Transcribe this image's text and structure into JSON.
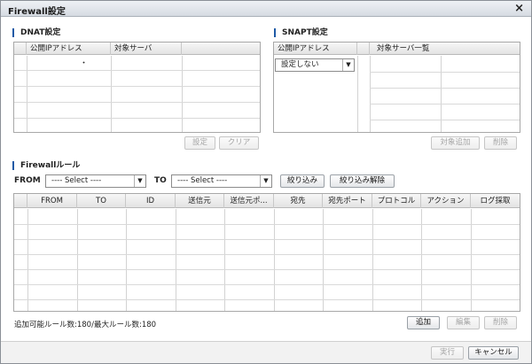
{
  "dialog": {
    "title": "Firewall設定",
    "close_icon": "×"
  },
  "dnat": {
    "title": "DNAT設定",
    "headers": [
      "公開IPアドレス",
      "対象サーバ"
    ],
    "first_cell": "・",
    "set_label": "設定",
    "clear_label": "クリア"
  },
  "snapt": {
    "title": "SNAPT設定",
    "headers": [
      "公開IPアドレス",
      "対象サーバ一覧"
    ],
    "select_value": "設定しない",
    "add_target_label": "対象追加",
    "delete_label": "削除"
  },
  "firewall": {
    "title": "Firewallルール",
    "from_label": "FROM",
    "to_label": "TO",
    "from_select": "---- Select ----",
    "to_select": "---- Select ----",
    "filter_label": "絞り込み",
    "clear_filter_label": "絞り込み解除",
    "columns": [
      "FROM",
      "TO",
      "ID",
      "送信元",
      "送信元ポ...",
      "宛先",
      "宛先ポート",
      "プロトコル",
      "アクション",
      "ログ採取"
    ],
    "rule_count": "追加可能ルール数:180/最大ルール数:180",
    "add_label": "追加",
    "edit_label": "編集",
    "delete_label": "削除"
  },
  "footer": {
    "execute_label": "実行",
    "cancel_label": "キャンセル"
  }
}
